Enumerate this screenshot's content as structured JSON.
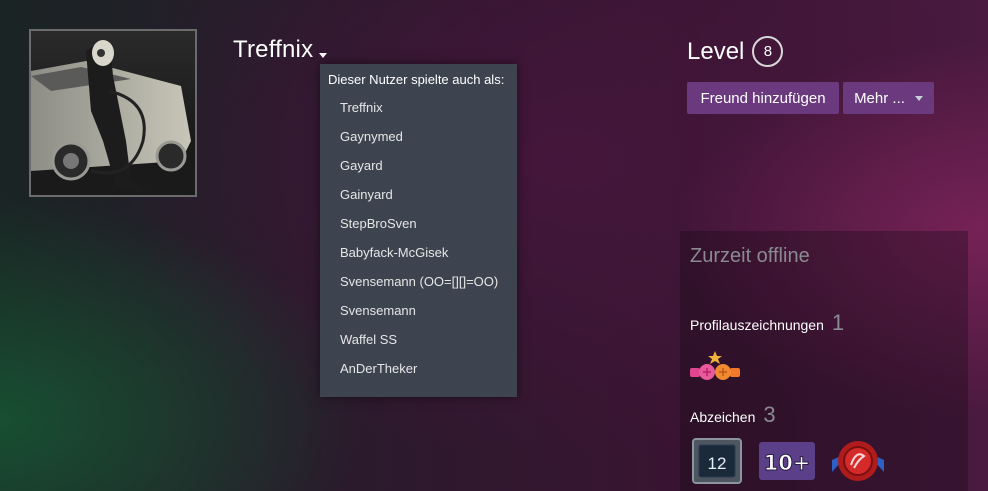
{
  "profile": {
    "persona_name": "Treffnix",
    "avatar_icon": "avatar-gasmask-car-image"
  },
  "alias_dropdown": {
    "header": "Dieser Nutzer spielte auch als:",
    "aliases": [
      "Treffnix",
      "Gaynymed",
      "Gayard",
      "Gainyard",
      "StepBroSven",
      "Babyfack-McGisek",
      "Svensemann (OO=[][]=OO)",
      "Svensemann",
      "Waffel SS",
      "AnDerTheker"
    ]
  },
  "level": {
    "label": "Level",
    "value": "8"
  },
  "actions": {
    "add_friend": "Freund hinzufügen",
    "more": "Mehr ..."
  },
  "side_panel": {
    "status": "Zurzeit offline",
    "awards_label": "Profilauszeichnungen",
    "awards_count": "1",
    "badges_label": "Abzeichen",
    "badges_count": "3",
    "badges": [
      {
        "icon": "years-of-service-badge-icon",
        "text": "12"
      },
      {
        "icon": "games-owned-badge-icon",
        "text": "10+"
      },
      {
        "icon": "wax-seal-badge-icon"
      }
    ]
  },
  "colors": {
    "button_bg": "#6b3a7e",
    "dropdown_bg": "#3d4450",
    "muted_text": "#8a8a92"
  }
}
